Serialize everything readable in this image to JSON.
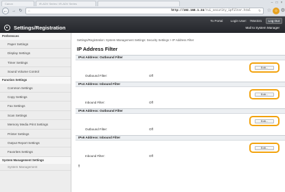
{
  "browser": {
    "tabs": [
      "Canon",
      "iR-ADV Series / iR-ADV Series",
      ""
    ],
    "url_host": "http://192.168.1.24",
    "url_path": "/rui_security_ipfilter.html",
    "lock": "⌂",
    "go": "↻",
    "star": "☆",
    "sun": "☼",
    "gear": "⚙",
    "back": "←",
    "forward": "→",
    "reload": "↻",
    "win_min": "‒",
    "win_max": "□",
    "win_close": "×"
  },
  "header": {
    "title": "Settings/Registration",
    "portal": "To Portal",
    "login_user_label": "Login User:",
    "login_user": "7654321",
    "logout": "Log Out",
    "mail": "Mail to System Manager"
  },
  "sidebar": {
    "preferences_label": "Preferences",
    "preferences": [
      "Paper Settings",
      "Display Settings",
      "Timer Settings",
      "Sound Volume Control"
    ],
    "function_label": "Function Settings",
    "function": [
      "Common Settings",
      "Copy Settings",
      "Fax Settings",
      "Scan Settings",
      "Memory Media Print Settings",
      "Printer Settings",
      "Output Report Settings",
      "Favorites Settings"
    ],
    "system_label": "System Management Settings",
    "system": [
      "System Management"
    ]
  },
  "main": {
    "breadcrumb": "Settings/Registration: System Management Settings: Security Settings > IP Address Filter",
    "title": "IP Address Filter",
    "sections": [
      {
        "header": "IPv4 Address: Outbound Filter",
        "label": "Outbound Filter:",
        "value": "Off",
        "edit": "Edit..."
      },
      {
        "header": "IPv4 Address: Inbound Filter",
        "label": "Inbound Filter:",
        "value": "Off",
        "edit": "Edit..."
      },
      {
        "header": "IPv6 Address: Outbound Filter",
        "label": "Outbound Filter:",
        "value": "Off",
        "edit": "Edit..."
      },
      {
        "header": "IPv6 Address: Inbound Filter",
        "label": "Inbound Filter:",
        "value": "Off",
        "edit": "Edit..."
      }
    ],
    "back_to_top": "⭱"
  },
  "colors": {
    "highlight": "#f2a20c",
    "header_bg": "#2b2d31"
  }
}
